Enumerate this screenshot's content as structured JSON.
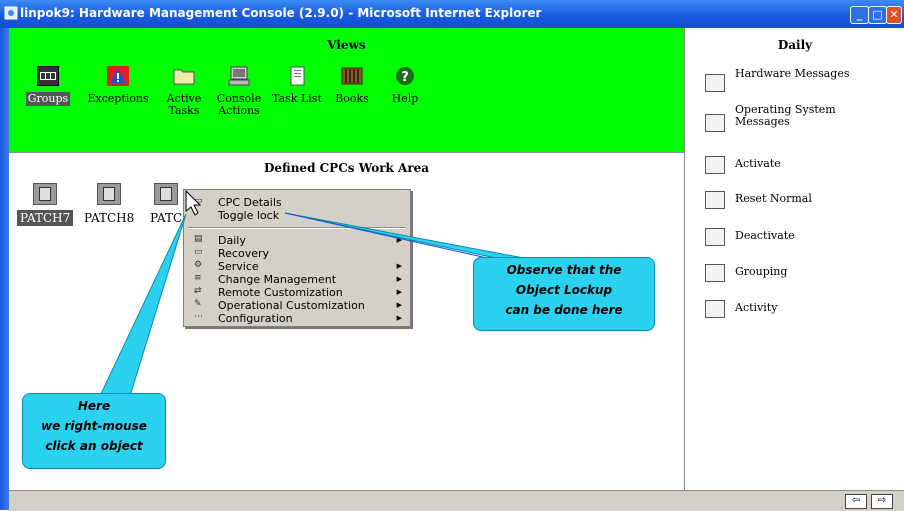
{
  "window": {
    "title": "linpok9: Hardware Management Console (2.9.0) - Microsoft Internet Explorer"
  },
  "views": {
    "heading": "Views",
    "items": [
      {
        "label": "Groups",
        "icon": "groups-icon",
        "selected": true
      },
      {
        "label": "Exceptions",
        "icon": "exceptions-icon"
      },
      {
        "label": "Active Tasks",
        "icon": "folder-icon"
      },
      {
        "label": "Console Actions",
        "icon": "console-icon"
      },
      {
        "label": "Task List",
        "icon": "task-list-icon"
      },
      {
        "label": "Books",
        "icon": "books-icon"
      },
      {
        "label": "Help",
        "icon": "help-icon"
      }
    ]
  },
  "workarea": {
    "heading": "Defined CPCs Work Area",
    "cpcs": [
      {
        "label": "PATCH7",
        "selected": true
      },
      {
        "label": "PATCH8"
      },
      {
        "label": "PATC"
      }
    ]
  },
  "sidebar": {
    "heading": "Daily",
    "tasks": [
      {
        "label": "Hardware Messages",
        "icon": "hardware-messages-icon"
      },
      {
        "label": "Operating System Messages",
        "icon": "os-messages-icon"
      },
      {
        "label": "Activate",
        "icon": "activate-icon"
      },
      {
        "label": "Reset Normal",
        "icon": "reset-normal-icon"
      },
      {
        "label": "Deactivate",
        "icon": "deactivate-icon"
      },
      {
        "label": "Grouping",
        "icon": "grouping-icon"
      },
      {
        "label": "Activity",
        "icon": "activity-icon"
      }
    ]
  },
  "context_menu": {
    "items": [
      {
        "label": "CPC Details"
      },
      {
        "label": "Toggle lock"
      },
      {
        "label": "Daily",
        "submenu": true
      },
      {
        "label": "Recovery"
      },
      {
        "label": "Service",
        "submenu": true
      },
      {
        "label": "Change Management",
        "submenu": true
      },
      {
        "label": "Remote Customization",
        "submenu": true
      },
      {
        "label": "Operational Customization",
        "submenu": true
      },
      {
        "label": "Configuration",
        "submenu": true
      }
    ]
  },
  "callouts": {
    "lock": {
      "line1": "Observe that the",
      "line2": "Object  Lockup",
      "line3": "can be done here"
    },
    "click": {
      "line1": "Here",
      "line2": "we right-mouse",
      "line3": "click an object"
    }
  },
  "colors": {
    "views_bg": "#00ff00",
    "callout_bg": "#2ad2f0",
    "titlebar": "#1a5ae0"
  }
}
